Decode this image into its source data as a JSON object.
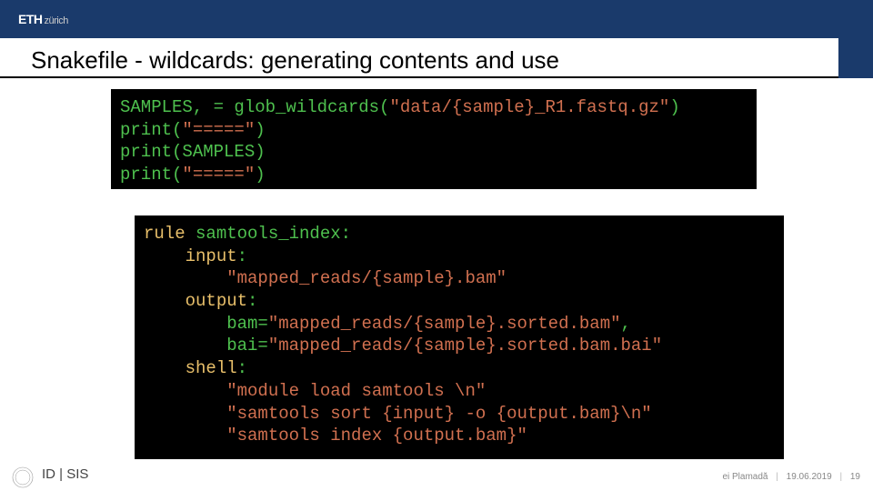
{
  "header": {
    "logo_main": "ETH",
    "logo_sub": "zürich"
  },
  "title": "Snakefile - wildcards: generating contents and use",
  "code1": {
    "l1a": "SAMPLES, = glob_wildcards(",
    "l1b": "\"data/{sample}_R1.fastq.gz\"",
    "l1c": ")",
    "l2a": "print(",
    "l2b": "\"=====\"",
    "l2c": ")",
    "l3a": "print(SAMPLES)",
    "l4a": "print(",
    "l4b": "\"=====\"",
    "l4c": ")"
  },
  "code2": {
    "rule_kw": "rule",
    "rule_name": " samtools_index:",
    "input_kw": "input",
    "input_colon": ":",
    "input_val": "\"mapped_reads/{sample}.bam\"",
    "output_kw": "output",
    "output_colon": ":",
    "out_bam_key": "bam=",
    "out_bam_val": "\"mapped_reads/{sample}.sorted.bam\"",
    "comma": ",",
    "out_bai_key": "bai=",
    "out_bai_val": "\"mapped_reads/{sample}.sorted.bam.bai\"",
    "shell_kw": "shell",
    "shell_colon": ":",
    "sh1": "\"module load samtools \\n\"",
    "sh2": "\"samtools sort {input} -o {output.bam}\\n\"",
    "sh3": "\"samtools index {output.bam}\""
  },
  "footer": {
    "left": "ID | SIS",
    "author": "ei Plamadă",
    "date": "19.06.2019",
    "page": "19"
  }
}
